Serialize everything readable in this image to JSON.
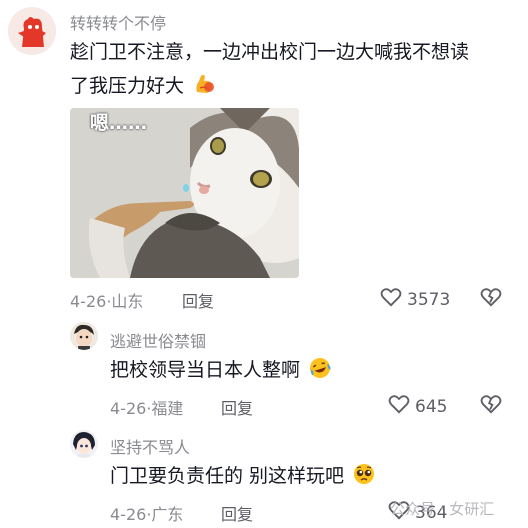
{
  "comments": [
    {
      "username": "转转转个不停",
      "text_line1": "趁门卫不注意，一边冲出校门一边大喊我不想读",
      "text_line2": "了我压力好大",
      "emoji": "flexed-biceps",
      "image_caption": "嗯……",
      "date": "4-26",
      "location": "山东",
      "reply_label": "回复",
      "likes": "3573"
    },
    {
      "username": "逃避世俗禁锢",
      "text": "把校领导当日本人整啊",
      "emoji": "laughing-tears",
      "date": "4-26",
      "location": "福建",
      "reply_label": "回复",
      "likes": "645"
    },
    {
      "username": "坚持不骂人",
      "text": "门卫要负责任的 别这样玩吧",
      "emoji": "pleading-face",
      "date": "4-26",
      "location": "广东",
      "reply_label": "回复",
      "likes": "364"
    }
  ],
  "watermark": "公众号 · 女研汇",
  "colors": {
    "text": "#161823",
    "meta": "#8a8b91",
    "reply": "#5d5e66"
  }
}
